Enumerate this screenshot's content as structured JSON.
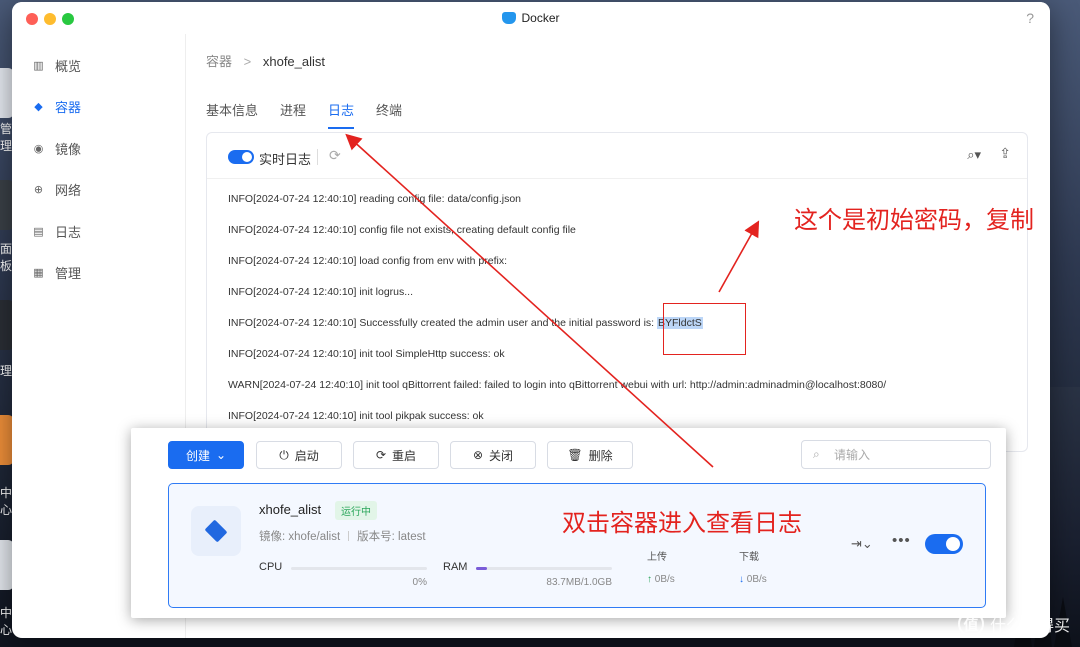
{
  "window": {
    "title": "Docker",
    "help": "?"
  },
  "desktop": {
    "fragments": [
      "管理",
      "面板",
      "理",
      "中心",
      "中心"
    ]
  },
  "sidebar": {
    "items": [
      {
        "label": "概览",
        "icon": "overview-icon"
      },
      {
        "label": "容器",
        "icon": "container-icon",
        "active": true
      },
      {
        "label": "镜像",
        "icon": "image-icon"
      },
      {
        "label": "网络",
        "icon": "network-icon"
      },
      {
        "label": "日志",
        "icon": "log-icon"
      },
      {
        "label": "管理",
        "icon": "manage-icon"
      }
    ]
  },
  "breadcrumb": {
    "parent": "容器",
    "separator": ">",
    "current": "xhofe_alist"
  },
  "tabs": [
    {
      "label": "基本信息"
    },
    {
      "label": "进程"
    },
    {
      "label": "日志",
      "active": true
    },
    {
      "label": "终端"
    }
  ],
  "log": {
    "realtime_label": "实时日志",
    "realtime_on": true,
    "lines": [
      "INFO[2024-07-24 12:40:10] reading config file: data/config.json",
      "INFO[2024-07-24 12:40:10] config file not exists, creating default config file",
      "INFO[2024-07-24 12:40:10] load config from env with prefix:",
      "INFO[2024-07-24 12:40:10] init logrus...",
      "INFO[2024-07-24 12:40:10] Successfully created the admin user and the initial password is: ",
      "INFO[2024-07-24 12:40:10] init tool SimpleHttp success: ok",
      "WARN[2024-07-24 12:40:10] init tool qBittorrent failed: failed to login into qBittorrent webui with url: http://admin:adminadmin@localhost:8080/",
      "INFO[2024-07-24 12:40:10] init tool pikpak success: ok"
    ],
    "password": "BYFldctS"
  },
  "popup": {
    "buttons": {
      "create": "创建",
      "start": "启动",
      "restart": "重启",
      "stop": "关闭",
      "delete": "删除"
    },
    "search_placeholder": "请输入",
    "container": {
      "name": "xhofe_alist",
      "status": "运行中",
      "image_label": "镜像: xhofe/alist",
      "version_label": "版本号: latest",
      "cpu_label": "CPU",
      "cpu_value": "0%",
      "cpu_fraction": 0.0,
      "ram_label": "RAM",
      "ram_value": "83.7MB/1.0GB",
      "ram_fraction": 0.08,
      "upload_label": "上传",
      "upload_value": "0B/s",
      "download_label": "下载",
      "download_value": "0B/s",
      "running": true
    }
  },
  "annotations": {
    "password_note": "这个是初始密码，复制",
    "double_click_note": "双击容器进入查看日志"
  },
  "watermark": {
    "logo": "值",
    "text": "什么值得买"
  },
  "colors": {
    "accent": "#1a6cf0",
    "annotation": "#e3231f",
    "running": "#2aa65a"
  }
}
